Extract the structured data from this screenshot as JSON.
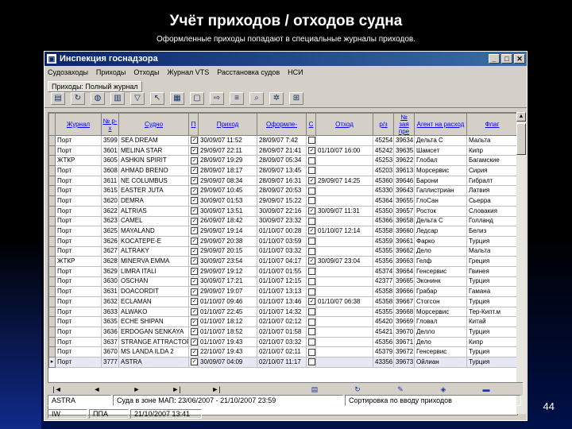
{
  "slide": {
    "title": "Учёт приходов / отходов судна",
    "subtitle": "Оформленные приходы попадают в специальные журналы приходов.",
    "page_number": "44"
  },
  "window": {
    "title": "Инспекция госнадзора",
    "menu": [
      "Судозаходы",
      "Приходы",
      "Отходы",
      "Журнал VTS",
      "Расстановка судов",
      "НСИ"
    ],
    "doc_tab": "Приходы: Полный журнал",
    "toolbar_icons": [
      "folder-icon",
      "refresh-icon",
      "globe-icon",
      "print-icon",
      "filter-icon",
      "cursor-icon",
      "calendar-icon",
      "document-icon",
      "export-icon",
      "list-icon",
      "search-icon",
      "gear-icon",
      "grid-icon"
    ]
  },
  "grid": {
    "columns": [
      "Журнал",
      "№ р-х",
      "Судно",
      "П",
      "Приход",
      "Оформле-",
      "С",
      "Отход",
      "р/з",
      "№ зая пре",
      "Агент на расход",
      "Флаг"
    ],
    "rows": [
      [
        "Порт",
        "3599",
        "SEA DREAM",
        "1",
        "30/09/07 11:52",
        "28/09/07 7:42",
        "0",
        "",
        "45254",
        "39634",
        "Дельта С",
        "Мальта"
      ],
      [
        "Порт",
        "3601",
        "MELINA STAR",
        "1",
        "29/09/07 22:11",
        "28/09/07 21:41",
        "1",
        "01/10/07 16:00",
        "45242",
        "39635",
        "Шамсет",
        "Кипр"
      ],
      [
        "ЖТКР",
        "3605",
        "ASHKIN SPIRIT",
        "1",
        "28/09/07 19:29",
        "28/09/07 05:34",
        "0",
        "",
        "45253",
        "39622",
        "Глобал",
        "Багамские"
      ],
      [
        "Порт",
        "3608",
        "AHMAD BRENO",
        "1",
        "28/09/07 18:17",
        "28/09/07 13:45",
        "0",
        "",
        "45203",
        "39613",
        "Морсервис",
        "Сирия"
      ],
      [
        "Порт",
        "3611",
        "NE COLUMBUS",
        "1",
        "29/09/07 08:34",
        "28/09/07 16:31",
        "1",
        "29/09/07 14:25",
        "45360",
        "39646",
        "Барони",
        "Гибралт"
      ],
      [
        "Порт",
        "3615",
        "EASTER JUTA",
        "1",
        "29/09/07 10:45",
        "28/09/07 20:53",
        "0",
        "",
        "45330",
        "39643",
        "Галлистриан",
        "Латвия"
      ],
      [
        "Порт",
        "3620",
        "DEMRA",
        "1",
        "30/09/07 01:53",
        "29/09/07 15:22",
        "0",
        "",
        "45364",
        "39655",
        "ГлоСан",
        "Сьерра"
      ],
      [
        "Порт",
        "3622",
        "ALTRIAS",
        "1",
        "30/09/07 13:51",
        "30/09/07 22:16",
        "1",
        "30/09/07 11:31",
        "45350",
        "39657",
        "Росток",
        "Словакия"
      ],
      [
        "Порт",
        "3623",
        "CAMEL",
        "1",
        "26/09/07 18:42",
        "30/09/07 23:32",
        "0",
        "",
        "45366",
        "39658",
        "Дельта С",
        "Голланд"
      ],
      [
        "Порт",
        "3625",
        "MAYALAND",
        "1",
        "29/09/07 19:14",
        "01/10/07 00:28",
        "1",
        "01/10/07 12:14",
        "45358",
        "39660",
        "Ледсар",
        "Белиз"
      ],
      [
        "Порт",
        "3626",
        "KOCATEPE-E",
        "1",
        "29/09/07 20:38",
        "01/10/07 03:59",
        "0",
        "",
        "45359",
        "39661",
        "Фарко",
        "Турция"
      ],
      [
        "Порт",
        "3627",
        "ALTRAKY",
        "1",
        "29/09/07 20:15",
        "01/10/07 03:32",
        "0",
        "",
        "45355",
        "39662",
        "Дело",
        "Мальта"
      ],
      [
        "ЖТКР",
        "3628",
        "MINERVA EMMA",
        "1",
        "30/09/07 23:54",
        "01/10/07 04:17",
        "1",
        "30/09/07 23:04",
        "45356",
        "39663",
        "Гелф",
        "Греция"
      ],
      [
        "Порт",
        "3629",
        "LIMRA ITALI",
        "1",
        "29/09/07 19:12",
        "01/10/07 01:55",
        "0",
        "",
        "45374",
        "39664",
        "Генсервис",
        "Гвинея"
      ],
      [
        "Порт",
        "3630",
        "OSCHAN",
        "1",
        "30/09/07 17:21",
        "01/10/07 12:15",
        "0",
        "",
        "42377",
        "39665",
        "Эконинк",
        "Турция"
      ],
      [
        "Порт",
        "3631",
        "DOACORDIT",
        "1",
        "29/09/07 19:07",
        "01/10/07 13:13",
        "0",
        "",
        "45358",
        "39666",
        "Грабар",
        "Гамана"
      ],
      [
        "Порт",
        "3632",
        "ECLAMAN",
        "1",
        "01/10/07 09:46",
        "01/10/07 13:46",
        "1",
        "01/10/07 06:38",
        "45358",
        "39667",
        "Стогсон",
        "Турция"
      ],
      [
        "Порт",
        "3633",
        "ALWAKO",
        "1",
        "01/10/07 22:45",
        "01/10/07 14:32",
        "0",
        "",
        "45355",
        "39668",
        "Морсервис",
        "Тер-Кипт.м"
      ],
      [
        "Порт",
        "3635",
        "ECHE SHIPAN",
        "1",
        "01/10/07 18:12",
        "02/10/07 02:12",
        "0",
        "",
        "45420",
        "39669",
        "Гловал",
        "Китай"
      ],
      [
        "Порт",
        "3636",
        "ERDOGAN SENKAYA",
        "1",
        "01/10/07 18:52",
        "02/10/07 01:58",
        "0",
        "",
        "45421",
        "39670",
        "Делло",
        "Турция"
      ],
      [
        "Порт",
        "3637",
        "STRANGE ATTRACTOR",
        "1",
        "01/10/07 19:43",
        "02/10/07 03:32",
        "0",
        "",
        "45356",
        "39671",
        "Дело",
        "Кипр"
      ],
      [
        "Порт",
        "3670",
        "MS LANDA ILDA 2",
        "1",
        "22/10/07 19:43",
        "02/10/07 02:11",
        "0",
        "",
        "45379",
        "39672",
        "Генсервис",
        "Турция"
      ],
      [
        "Порт",
        "3777",
        "ASTRA",
        "1",
        "30/09/07 04:09",
        "02/10/07 11:17",
        "0",
        "",
        "43356",
        "39673",
        "Ойлиан",
        "Турция"
      ]
    ]
  },
  "nav": {
    "first": "|◄",
    "prev": "◄",
    "play": "►",
    "next": "►|",
    "last": "►|"
  },
  "status": {
    "vessel": "ASTRA",
    "period": "Суда в зоне МАП: 23/06/2007 - 21/10/2007 23:59",
    "sort": "Сортировка по вводу приходов",
    "mode": "IW",
    "field": "ППА",
    "datetime": "21/10/2007 13:41"
  }
}
